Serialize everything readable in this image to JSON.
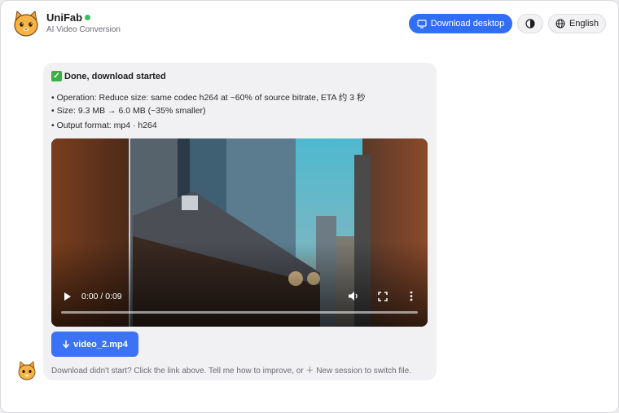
{
  "app": {
    "name": "UniFab",
    "subtitle": "AI Video Conversion",
    "status_color": "#2fc55a"
  },
  "header": {
    "download_desktop_label": "Download desktop",
    "language_label": "English",
    "accent_color": "#2f6ef5"
  },
  "message": {
    "title": "Done, download started",
    "lines": [
      "• Operation: Reduce size: same codec h264 at ~60% of source bitrate, ETA 约 3 秒",
      "• Size: 9.3 MB → 6.0 MB (~35% smaller)",
      "• Output format: mp4 · h264"
    ],
    "file_button_label": "video_2.mp4",
    "hint": "Download didn't start? Click the link above. Tell me how to improve, or ＋ New session to switch file."
  },
  "player": {
    "time_display": "0:00 / 0:09",
    "progress_fraction": 0.0,
    "compare_split_fraction": 0.21
  },
  "icons": {
    "logo": "cat-face-icon",
    "desktop": "monitor-icon",
    "theme": "contrast-icon",
    "language": "globe-icon",
    "play": "play-icon",
    "volume": "volume-icon",
    "fullscreen": "fullscreen-icon",
    "more": "more-vertical-icon",
    "download": "download-arrow-icon"
  }
}
